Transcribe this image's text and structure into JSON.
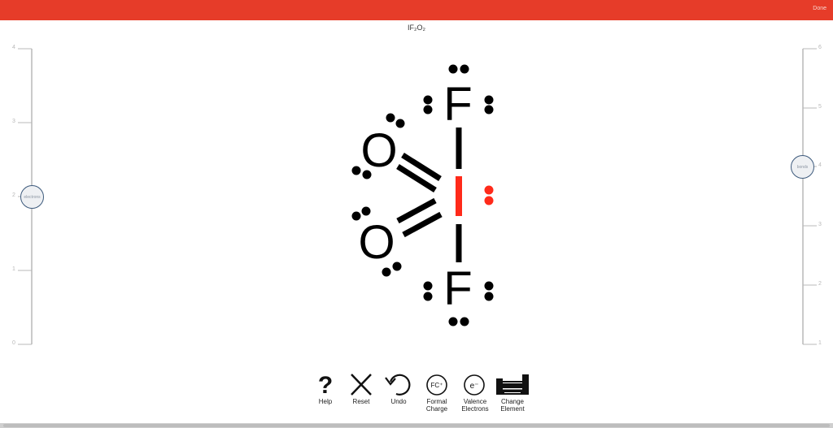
{
  "header": {
    "done_label": "Done",
    "accent_color": "#e63c29"
  },
  "molecule": {
    "formula": "IF₂O₂",
    "atoms": {
      "top_fluorine": "F",
      "bottom_fluorine": "F",
      "upper_oxygen": "O",
      "lower_oxygen": "O"
    },
    "highlight_color": "#ff2a1a"
  },
  "electrons_slider": {
    "knob_label": "electrons",
    "ticks": [
      "4",
      "3",
      "2",
      "1",
      "0"
    ],
    "value": 2
  },
  "bonds_slider": {
    "knob_label": "bonds",
    "ticks": [
      "6",
      "5",
      "4",
      "3",
      "2",
      "1"
    ],
    "value": 4
  },
  "toolbar": {
    "help": "Help",
    "reset": "Reset",
    "undo": "Undo",
    "formal_charge": "Formal\nCharge",
    "formal_charge_badge": "FC⁺",
    "valence_electrons": "Valence\nElectrons",
    "valence_badge": "e⁻",
    "change_element": "Change\nElement",
    "help_glyph": "?"
  }
}
